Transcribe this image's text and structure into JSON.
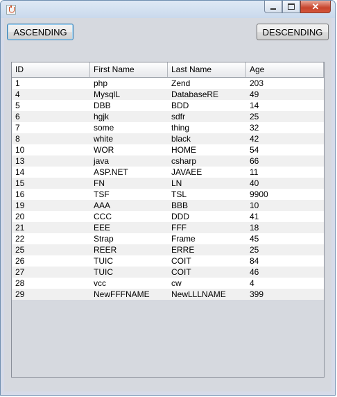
{
  "window": {
    "title": ""
  },
  "toolbar": {
    "ascending_label": "ASCENDING",
    "descending_label": "DESCENDING"
  },
  "table": {
    "columns": [
      "ID",
      "First Name",
      "Last Name",
      "Age"
    ],
    "rows": [
      [
        "1",
        "php",
        "Zend",
        "203"
      ],
      [
        "4",
        "MysqlL",
        "DatabaseRE",
        "49"
      ],
      [
        "5",
        "DBB",
        "BDD",
        "14"
      ],
      [
        "6",
        "hgjk",
        "sdfr",
        "25"
      ],
      [
        "7",
        "some",
        "thing",
        "32"
      ],
      [
        "8",
        "white",
        "black",
        "42"
      ],
      [
        "10",
        "WOR",
        "HOME",
        "54"
      ],
      [
        "13",
        "java",
        "csharp",
        "66"
      ],
      [
        "14",
        "ASP.NET",
        "JAVAEE",
        "11"
      ],
      [
        "15",
        "FN",
        "LN",
        "40"
      ],
      [
        "16",
        "TSF",
        "TSL",
        "9900"
      ],
      [
        "19",
        "AAA",
        "BBB",
        "10"
      ],
      [
        "20",
        "CCC",
        "DDD",
        "41"
      ],
      [
        "21",
        "EEE",
        "FFF",
        "18"
      ],
      [
        "22",
        "Strap",
        "Frame",
        "45"
      ],
      [
        "25",
        "REER",
        "ERRE",
        "25"
      ],
      [
        "26",
        "TUIC",
        "COIT",
        "84"
      ],
      [
        "27",
        "TUIC",
        "COIT",
        "46"
      ],
      [
        "28",
        "vcc",
        "cw",
        "4"
      ],
      [
        "29",
        "NewFFFNAME",
        "NewLLLNAME",
        "399"
      ]
    ]
  },
  "icons": {
    "app": "java-icon",
    "minimize": "minimize-icon",
    "maximize": "maximize-icon",
    "close": "close-icon"
  }
}
